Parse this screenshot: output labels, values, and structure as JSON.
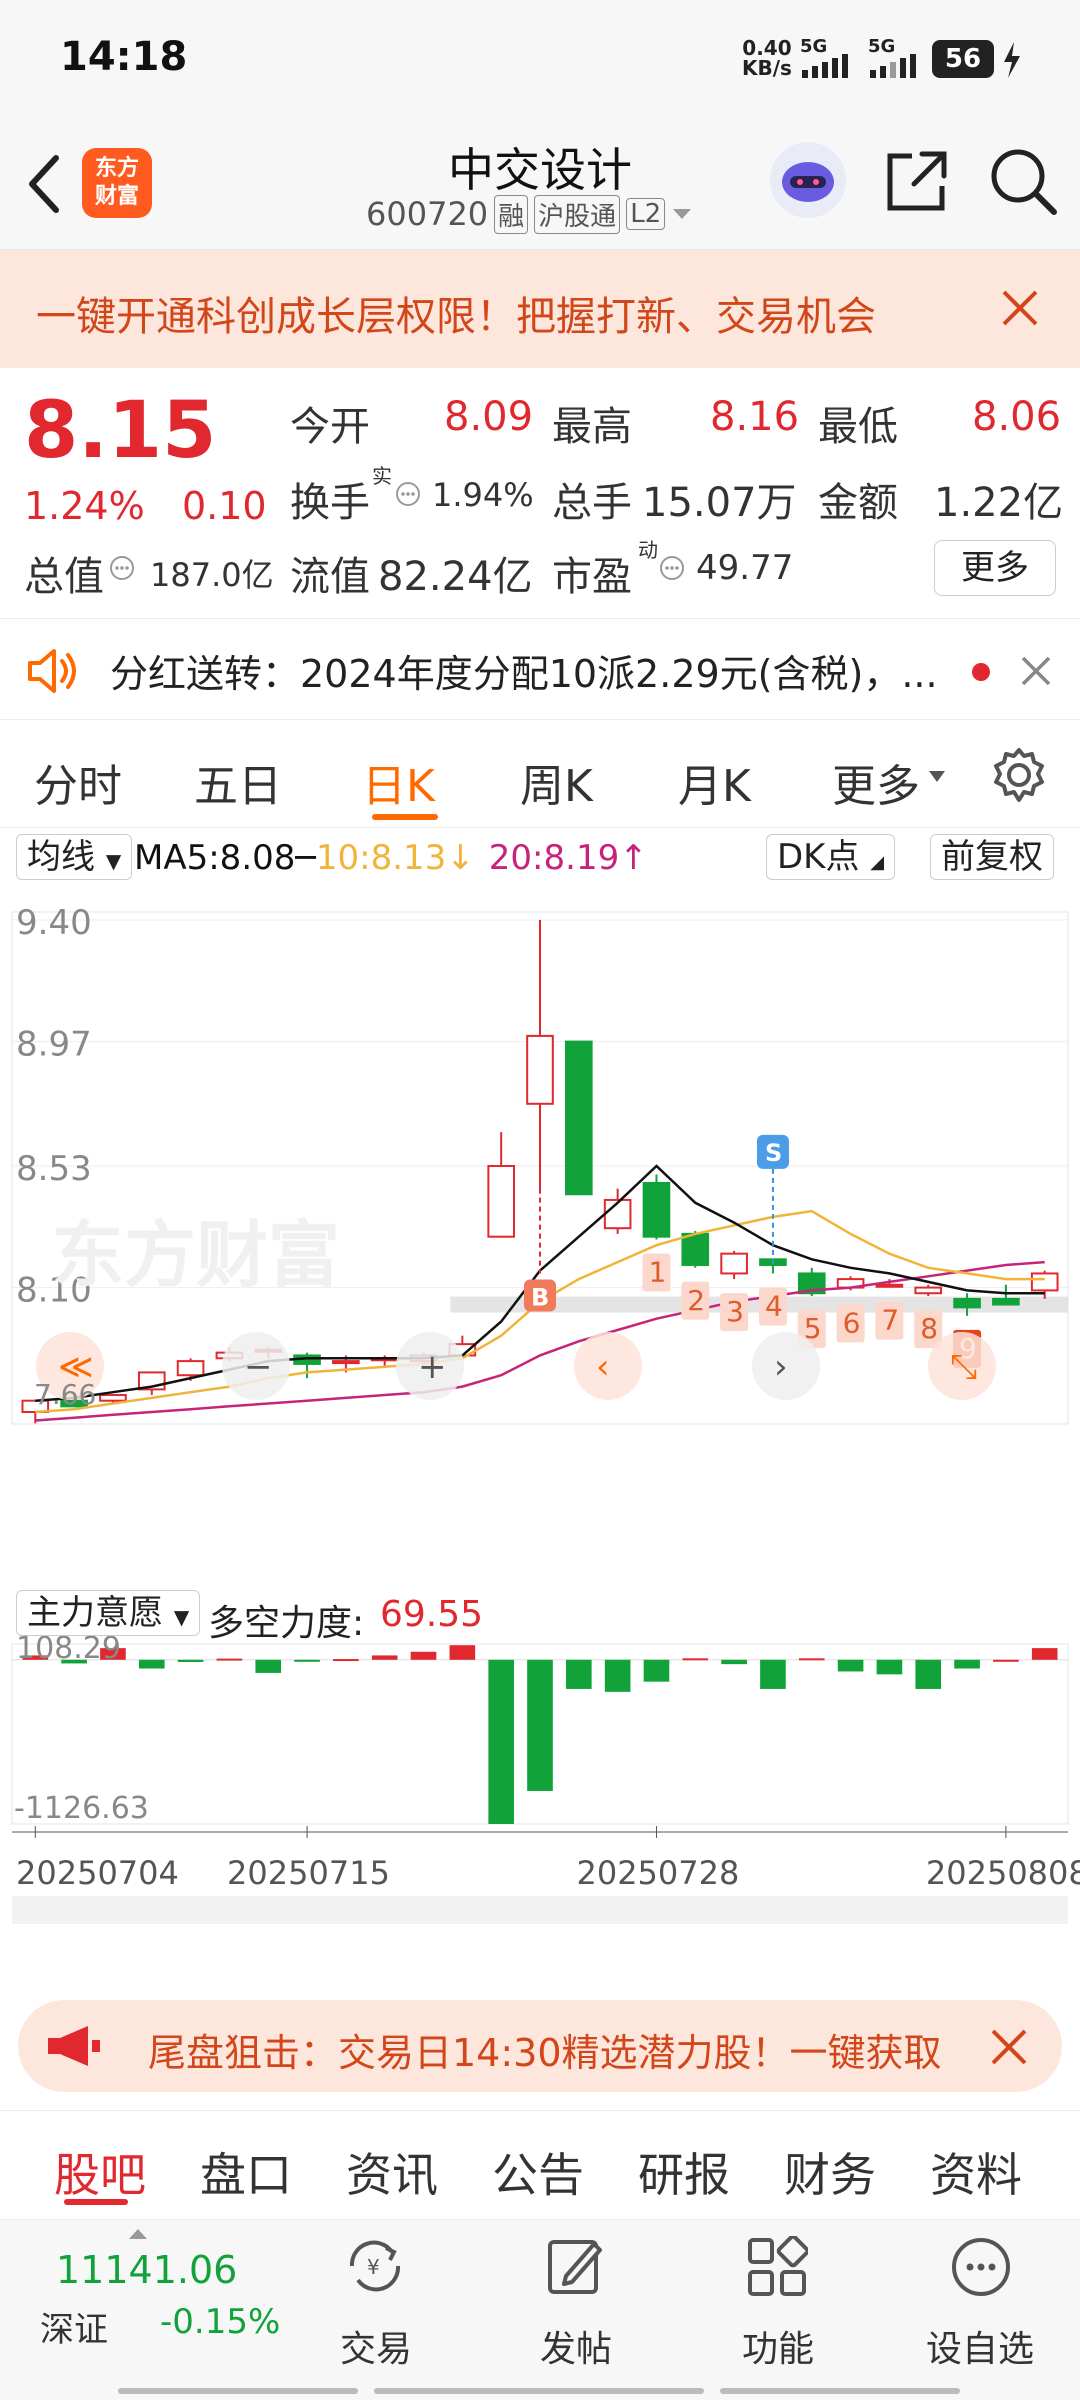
{
  "status_bar": {
    "time": "14:18",
    "net_speed": "0.40",
    "net_unit": "KB/s",
    "sim1": "5G",
    "sim2": "5G",
    "battery": "56"
  },
  "header": {
    "logo_text_1": "东方",
    "logo_text_2": "财富",
    "stock_name": "中交设计",
    "stock_code": "600720",
    "tag_margin": "融",
    "tag_connect": "沪股通",
    "tag_level": "L2"
  },
  "banner": {
    "text": "一键开通科创成长层权限！把握打新、交易机会"
  },
  "quote": {
    "price": "8.15",
    "change_pct": "1.24%",
    "change_abs": "0.10",
    "total_value_label": "总值",
    "total_value": "187.0亿",
    "open_label": "今开",
    "open": "8.09",
    "high_label": "最高",
    "high": "8.16",
    "low_label": "最低",
    "low": "8.06",
    "turnover_label": "换手",
    "turnover_sup": "实",
    "turnover": "1.94%",
    "volume_label": "总手",
    "volume": "15.07万",
    "amount_label": "金额",
    "amount": "1.22亿",
    "float_value_label": "流值",
    "float_value": "82.24亿",
    "pe_label": "市盈",
    "pe_sup": "动",
    "pe": "49.77",
    "more_label": "更多"
  },
  "notice": {
    "text": "分红送转：2024年度分配10派2.29元(含税)，..."
  },
  "period_tabs": [
    "分时",
    "五日",
    "日K",
    "周K",
    "月K",
    "更多"
  ],
  "active_period": "日K",
  "indicator_bar": {
    "ma_select": "均线",
    "ma5": "MA5:8.08",
    "ma10": "10:8.13",
    "ma20": "20:8.19",
    "dk_label": "DK点",
    "adjust_label": "前复权"
  },
  "colors": {
    "up": "#e0282e",
    "down": "#11a23a",
    "ma5": "#111111",
    "ma10": "#f0b43a",
    "ma20": "#c8237a",
    "accent": "#ff6a00"
  },
  "chart_data": {
    "type": "candlestick",
    "price_ticks": [
      "9.40",
      "8.97",
      "8.53",
      "8.10"
    ],
    "bottom_tick": "7.66",
    "ylim": [
      7.66,
      9.4
    ],
    "candles": [
      {
        "o": 7.66,
        "h": 7.7,
        "l": 7.62,
        "c": 7.7
      },
      {
        "o": 7.7,
        "h": 7.73,
        "l": 7.68,
        "c": 7.68
      },
      {
        "o": 7.7,
        "h": 7.72,
        "l": 7.69,
        "c": 7.72
      },
      {
        "o": 7.74,
        "h": 7.8,
        "l": 7.72,
        "c": 7.8
      },
      {
        "o": 7.79,
        "h": 7.85,
        "l": 7.77,
        "c": 7.84
      },
      {
        "o": 7.85,
        "h": 7.89,
        "l": 7.84,
        "c": 7.87
      },
      {
        "o": 7.88,
        "h": 7.89,
        "l": 7.85,
        "c": 7.88
      },
      {
        "o": 7.86,
        "h": 7.87,
        "l": 7.78,
        "c": 7.83
      },
      {
        "o": 7.84,
        "h": 7.86,
        "l": 7.8,
        "c": 7.84
      },
      {
        "o": 7.85,
        "h": 7.86,
        "l": 7.82,
        "c": 7.85
      },
      {
        "o": 7.84,
        "h": 7.87,
        "l": 7.82,
        "c": 7.86
      },
      {
        "o": 7.86,
        "h": 7.93,
        "l": 7.85,
        "c": 7.9
      },
      {
        "o": 8.28,
        "h": 8.65,
        "l": 8.28,
        "c": 8.53
      },
      {
        "o": 8.75,
        "h": 9.4,
        "l": 8.45,
        "c": 8.99
      },
      {
        "o": 8.97,
        "h": 8.97,
        "l": 8.43,
        "c": 8.43
      },
      {
        "o": 8.31,
        "h": 8.45,
        "l": 8.29,
        "c": 8.41
      },
      {
        "o": 8.47,
        "h": 8.5,
        "l": 8.27,
        "c": 8.28
      },
      {
        "o": 8.29,
        "h": 8.3,
        "l": 8.17,
        "c": 8.18
      },
      {
        "o": 8.15,
        "h": 8.23,
        "l": 8.13,
        "c": 8.22
      },
      {
        "o": 8.2,
        "h": 8.2,
        "l": 8.15,
        "c": 8.18
      },
      {
        "o": 8.15,
        "h": 8.17,
        "l": 8.07,
        "c": 8.08
      },
      {
        "o": 8.1,
        "h": 8.14,
        "l": 8.09,
        "c": 8.13
      },
      {
        "o": 8.11,
        "h": 8.13,
        "l": 8.1,
        "c": 8.11
      },
      {
        "o": 8.08,
        "h": 8.11,
        "l": 8.07,
        "c": 8.1
      },
      {
        "o": 8.06,
        "h": 8.08,
        "l": 8.0,
        "c": 8.03
      },
      {
        "o": 8.06,
        "h": 8.11,
        "l": 8.04,
        "c": 8.04
      },
      {
        "o": 8.09,
        "h": 8.16,
        "l": 8.06,
        "c": 8.15
      }
    ],
    "ma5": [
      7.7,
      7.71,
      7.73,
      7.75,
      7.78,
      7.81,
      7.84,
      7.85,
      7.85,
      7.85,
      7.85,
      7.86,
      7.98,
      8.16,
      8.28,
      8.4,
      8.53,
      8.4,
      8.33,
      8.25,
      8.2,
      8.17,
      8.15,
      8.12,
      8.09,
      8.08,
      8.08
    ],
    "ma10": [
      7.66,
      7.67,
      7.69,
      7.71,
      7.73,
      7.75,
      7.78,
      7.8,
      7.81,
      7.82,
      7.83,
      7.85,
      7.93,
      8.05,
      8.13,
      8.19,
      8.25,
      8.29,
      8.32,
      8.35,
      8.37,
      8.29,
      8.22,
      8.17,
      8.15,
      8.13,
      8.13
    ],
    "ma20": [
      7.63,
      7.64,
      7.65,
      7.66,
      7.67,
      7.68,
      7.69,
      7.7,
      7.71,
      7.72,
      7.73,
      7.75,
      7.79,
      7.86,
      7.91,
      7.95,
      7.99,
      8.02,
      8.05,
      8.07,
      8.09,
      8.1,
      8.12,
      8.14,
      8.16,
      8.18,
      8.19
    ],
    "signal_B_index": 13,
    "signal_S_index": 19,
    "countdown_labels": [
      "1",
      "2",
      "3",
      "4",
      "5",
      "6",
      "7",
      "8",
      "9"
    ],
    "watermark": "东方财富",
    "sub_indicator": "主力意愿",
    "force_label": "多空力度:",
    "force_value": "69.55",
    "sub_ticks": [
      "108.29",
      "-1126.63"
    ],
    "sub_ylim": [
      -1126.63,
      108.29
    ],
    "sub_values": [
      30,
      -25,
      80,
      -60,
      -15,
      8,
      -90,
      -8,
      5,
      30,
      55,
      100,
      -1126.63,
      -900,
      -200,
      -220,
      -150,
      10,
      -30,
      -200,
      10,
      -80,
      -100,
      -200,
      -60,
      0,
      80
    ],
    "dates": [
      "20250704",
      "20250715",
      "20250728",
      "20250808"
    ]
  },
  "promo": {
    "text": "尾盘狙击：交易日14:30精选潜力股！一键获取"
  },
  "sub_tabs": [
    "股吧",
    "盘口",
    "资讯",
    "公告",
    "研报",
    "财务",
    "资料"
  ],
  "active_sub_tab": "股吧",
  "bottom_bar": {
    "index_value": "11141.06",
    "index_name": "深证",
    "index_change": "-0.15%",
    "nav": [
      "交易",
      "发帖",
      "功能",
      "设自选"
    ]
  }
}
